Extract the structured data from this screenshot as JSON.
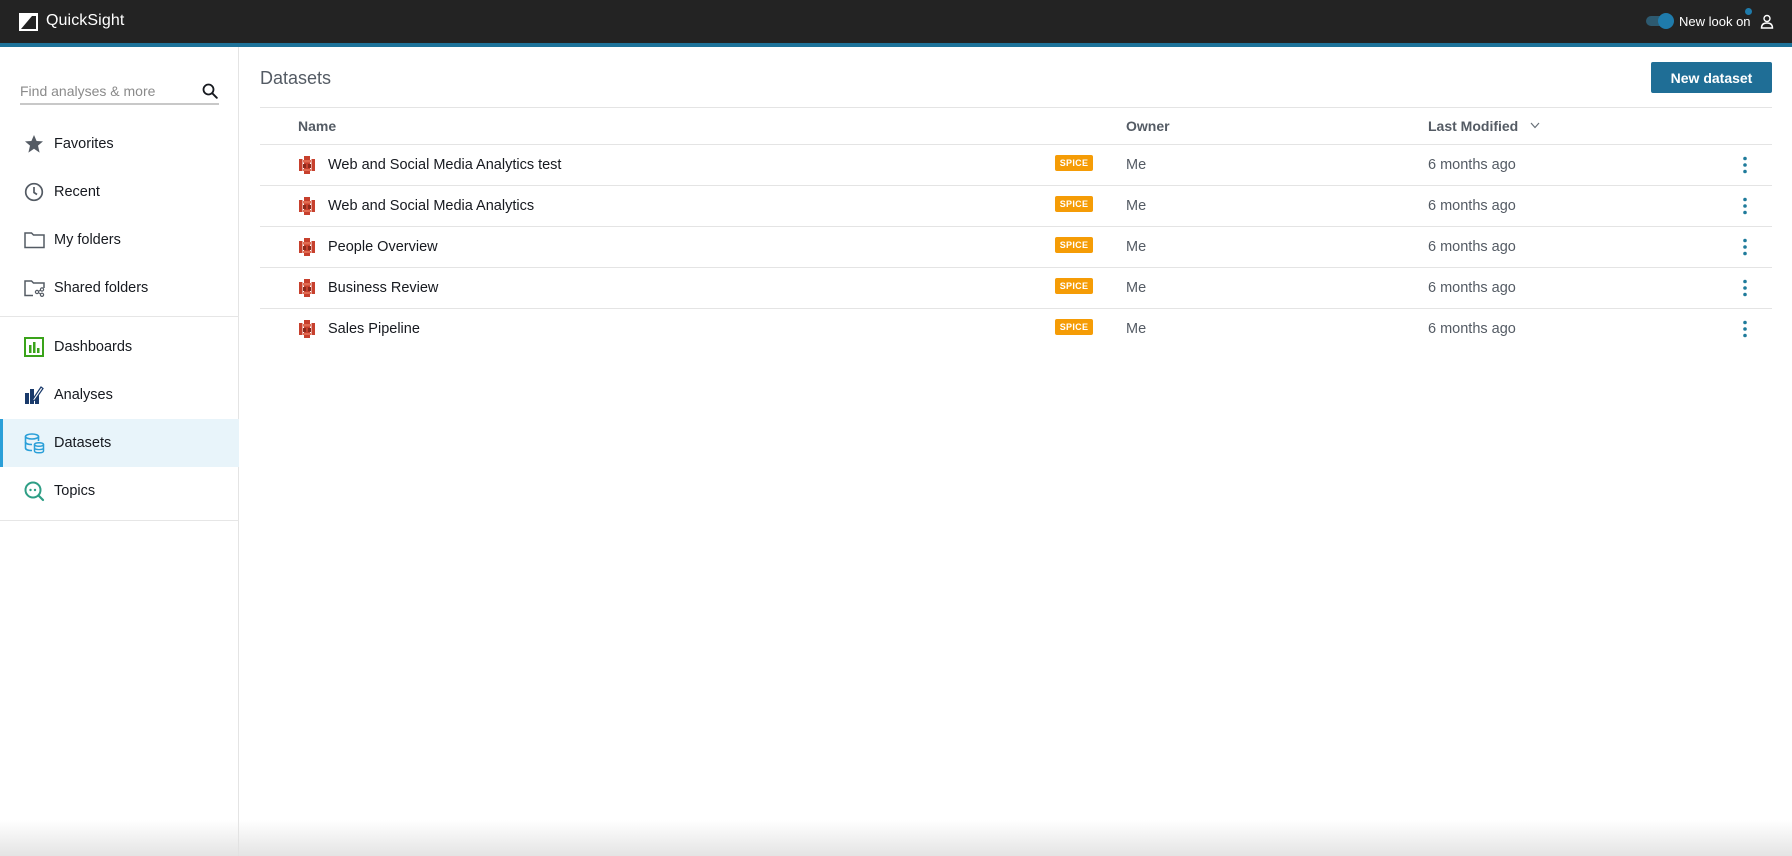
{
  "header": {
    "app_title": "QuickSight",
    "toggle_label": "New look on",
    "toggle_on": true,
    "colors": {
      "bar": "#232323",
      "accent_stripe": "#1d7299",
      "toggle": "#1f7bab"
    }
  },
  "sidebar": {
    "search": {
      "placeholder": "Find analyses & more",
      "value": ""
    },
    "items": [
      {
        "label": "Favorites",
        "icon": "star-icon",
        "active": false
      },
      {
        "label": "Recent",
        "icon": "clock-icon",
        "active": false
      },
      {
        "label": "My folders",
        "icon": "folder-icon",
        "active": false
      },
      {
        "label": "Shared folders",
        "icon": "shared-folder-icon",
        "active": false
      },
      {
        "label": "Dashboards",
        "icon": "dashboard-icon",
        "active": false
      },
      {
        "label": "Analyses",
        "icon": "analysis-icon",
        "active": false
      },
      {
        "label": "Datasets",
        "icon": "dataset-icon",
        "active": true
      },
      {
        "label": "Topics",
        "icon": "topic-icon",
        "active": false
      }
    ]
  },
  "main": {
    "title": "Datasets",
    "new_button_label": "New dataset",
    "table": {
      "columns": {
        "name": "Name",
        "owner": "Owner",
        "modified": "Last Modified"
      },
      "sort": {
        "column": "Last Modified",
        "direction": "descending"
      },
      "rows": [
        {
          "name": "Web and Social Media Analytics test",
          "badge": "SPICE",
          "owner": "Me",
          "modified": "6 months ago"
        },
        {
          "name": "Web and Social Media Analytics",
          "badge": "SPICE",
          "owner": "Me",
          "modified": "6 months ago"
        },
        {
          "name": "People Overview",
          "badge": "SPICE",
          "owner": "Me",
          "modified": "6 months ago"
        },
        {
          "name": "Business Review",
          "badge": "SPICE",
          "owner": "Me",
          "modified": "6 months ago"
        },
        {
          "name": "Sales Pipeline",
          "badge": "SPICE",
          "owner": "Me",
          "modified": "6 months ago"
        }
      ]
    },
    "colors": {
      "button": "#1f6e96",
      "badge": "#f59c06",
      "kebab": "#1f7b9b",
      "dataset_icon": "#c7402d",
      "active_nav_bg": "#e8f4fa"
    }
  }
}
